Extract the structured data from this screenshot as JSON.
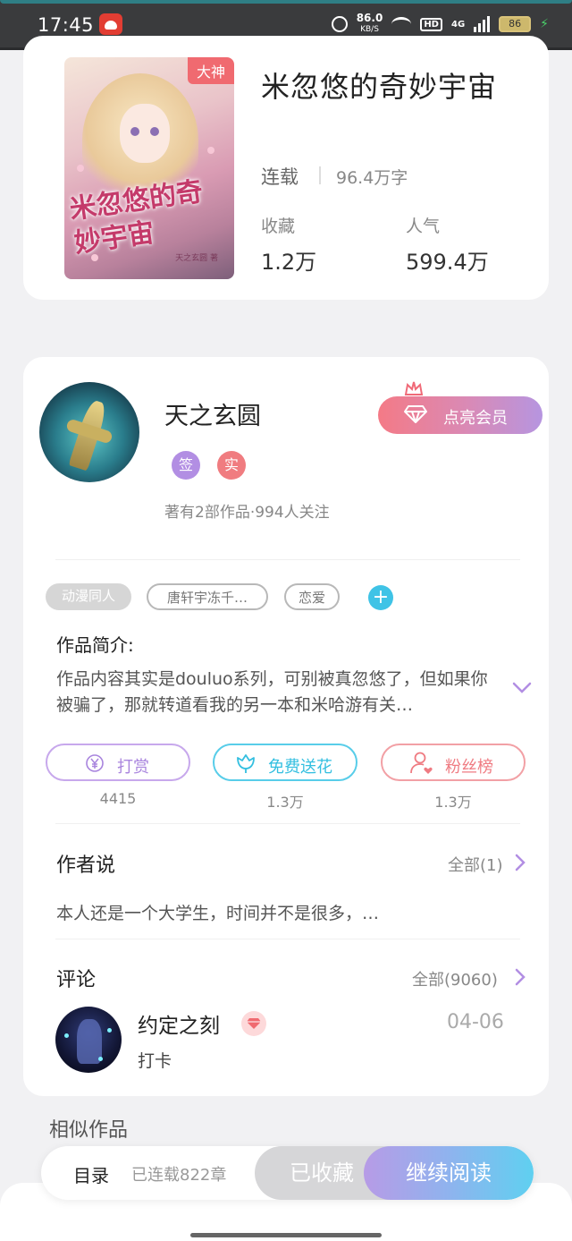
{
  "status_bar": {
    "time": "17:45",
    "net_speed": "86.0",
    "net_unit": "KB/S",
    "hd": "HD",
    "network": "4G",
    "battery": "86"
  },
  "book": {
    "cover_badge": "大神",
    "cover_title": "米忽悠的奇妙宇宙",
    "cover_author": "天之玄圆 著",
    "title": "米忽悠的奇妙宇宙",
    "status": "连载",
    "words": "96.4万字",
    "collect_label": "收藏",
    "collect_value": "1.2万",
    "popularity_label": "人气",
    "popularity_value": "599.4万"
  },
  "author": {
    "name": "天之玄圆",
    "badge_sign": "签",
    "badge_real": "实",
    "meta": "著有2部作品·994人关注",
    "vip_button": "点亮会员"
  },
  "tags": [
    "动漫同人",
    "唐轩宇冻千…",
    "恋爱"
  ],
  "tag_add": "+",
  "intro": {
    "title": "作品简介:",
    "text": "作品内容其实是douluo系列，可别被真忽悠了，但如果你被骗了，那就转道看我的另一本和米哈游有关…"
  },
  "actions": [
    {
      "label": "打赏",
      "count": "4415"
    },
    {
      "label": "免费送花",
      "count": "1.3万"
    },
    {
      "label": "粉丝榜",
      "count": "1.3万"
    }
  ],
  "author_says": {
    "title": "作者说",
    "more": "全部(1)",
    "text": "本人还是一个大学生，时间并不是很多，…"
  },
  "comments": {
    "title": "评论",
    "more": "全部(9060)",
    "items": [
      {
        "name": "约定之刻",
        "date": "04-06",
        "text": "打卡"
      }
    ]
  },
  "similar_title": "相似作品",
  "bottom_bar": {
    "catalog": "目录",
    "chapters": "已连载822章",
    "collected": "已收藏",
    "continue": "继续阅读"
  },
  "colors": {
    "accent_purple": "#b28ee3",
    "accent_blue": "#33bfe0",
    "accent_red": "#ef7b82"
  }
}
